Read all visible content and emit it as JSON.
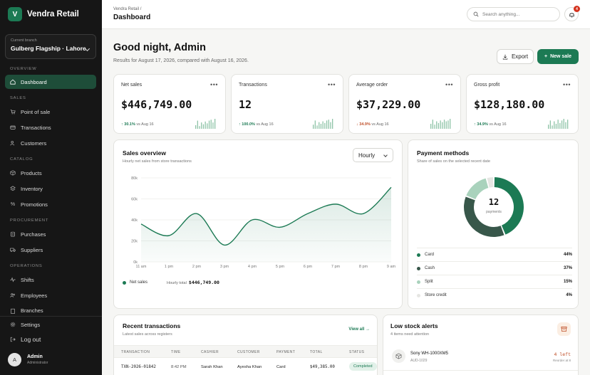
{
  "brand": {
    "logo_letter": "V",
    "name": "Vendra Retail"
  },
  "branch": {
    "label": "Current branch",
    "value": "Gulberg Flagship · Lahore"
  },
  "sidebar": {
    "sections": [
      {
        "title": "OVERVIEW",
        "items": [
          {
            "label": "Dashboard",
            "icon": "home-icon",
            "active": true
          }
        ]
      },
      {
        "title": "SALES",
        "items": [
          {
            "label": "Point of sale",
            "icon": "cart-icon"
          },
          {
            "label": "Transactions",
            "icon": "card-icon"
          },
          {
            "label": "Customers",
            "icon": "users-icon"
          }
        ]
      },
      {
        "title": "CATALOG",
        "items": [
          {
            "label": "Products",
            "icon": "box-icon"
          },
          {
            "label": "Inventory",
            "icon": "layers-icon"
          },
          {
            "label": "Promotions",
            "icon": "percent-icon"
          }
        ]
      },
      {
        "title": "PROCUREMENT",
        "items": [
          {
            "label": "Purchases",
            "icon": "clipboard-icon"
          },
          {
            "label": "Suppliers",
            "icon": "truck-icon"
          }
        ]
      },
      {
        "title": "OPERATIONS",
        "items": [
          {
            "label": "Shifts",
            "icon": "pulse-icon"
          },
          {
            "label": "Employees",
            "icon": "people-icon"
          },
          {
            "label": "Branches",
            "icon": "building-icon"
          }
        ]
      }
    ],
    "settings_label": "Settings",
    "logout_label": "Log out",
    "user": {
      "initial": "A",
      "name": "Admin",
      "role": "Administrator"
    }
  },
  "header": {
    "breadcrumb": "Vendra Retail /",
    "title": "Dashboard",
    "search_placeholder": "Search anything...",
    "notification_count": "4"
  },
  "greeting": {
    "title": "Good night, Admin",
    "subtitle": "Results for August 17, 2026, compared with August 16, 2026.",
    "export_label": "Export",
    "new_sale_label": "New sale"
  },
  "kpis": [
    {
      "label": "Net sales",
      "value": "$446,749.00",
      "delta": "30.1%",
      "direction": "up",
      "compare": "vs Aug 16",
      "spark": [
        4,
        9,
        3,
        7,
        5,
        8,
        6,
        9,
        10,
        7,
        11
      ]
    },
    {
      "label": "Transactions",
      "value": "12",
      "delta": "100.0%",
      "direction": "up",
      "compare": "vs Aug 16",
      "spark": [
        5,
        10,
        4,
        8,
        6,
        9,
        7,
        10,
        11,
        8,
        12
      ]
    },
    {
      "label": "Average order",
      "value": "$37,229.00",
      "delta": "34.9%",
      "direction": "down",
      "compare": "vs Aug 16",
      "spark": [
        6,
        11,
        5,
        9,
        7,
        10,
        8,
        11,
        9,
        10,
        12
      ]
    },
    {
      "label": "Gross profit",
      "value": "$128,180.00",
      "delta": "34.9%",
      "direction": "up",
      "compare": "vs Aug 16",
      "spark": [
        5,
        10,
        4,
        9,
        6,
        11,
        7,
        10,
        12,
        8,
        11
      ]
    }
  ],
  "sales_overview": {
    "title": "Sales overview",
    "subtitle": "Hourly net sales from store transactions",
    "range": "Hourly",
    "legend": "Net sales",
    "hourly_total_label": "Hourly total",
    "hourly_total_value": "$446,749.00",
    "color": "#1c7a54"
  },
  "chart_data": {
    "type": "area",
    "categories": [
      "11 am",
      "1 pm",
      "2 pm",
      "3 pm",
      "4 pm",
      "5 pm",
      "6 pm",
      "7 pm",
      "8 pm",
      "9 am"
    ],
    "series": [
      {
        "name": "Net sales",
        "values": [
          36000,
          25000,
          46000,
          16000,
          40000,
          33000,
          46000,
          55000,
          46000,
          71000
        ]
      }
    ],
    "yticks": [
      "0k",
      "20k",
      "40k",
      "60k",
      "80k"
    ],
    "ylim": [
      0,
      80000
    ],
    "grid": true
  },
  "payment_methods": {
    "title": "Payment methods",
    "subtitle": "Share of sales on the selected recent date",
    "center_value": "12",
    "center_label": "payments",
    "items": [
      {
        "label": "Card",
        "pct": "44%",
        "value": 44,
        "color": "#1c7a54"
      },
      {
        "label": "Cash",
        "pct": "37%",
        "value": 37,
        "color": "#38574a"
      },
      {
        "label": "Split",
        "pct": "15%",
        "value": 15,
        "color": "#a9d2bc"
      },
      {
        "label": "Store credit",
        "pct": "4%",
        "value": 4,
        "color": "#e6e6e3"
      }
    ]
  },
  "recent_transactions": {
    "title": "Recent transactions",
    "subtitle": "Latest sales across registers",
    "view_all": "View all →",
    "columns": [
      "TRANSACTION",
      "TIME",
      "CASHIER",
      "CUSTOMER",
      "PAYMENT",
      "TOTAL",
      "STATUS"
    ],
    "rows": [
      {
        "id": "TXN-2026-01842",
        "time": "8:42 PM",
        "cashier": "Sarah Khan",
        "customer": "Ayesha Khan",
        "payment": "Card",
        "total": "$49,385.00",
        "status": "Completed"
      }
    ]
  },
  "low_stock": {
    "title": "Low stock alerts",
    "subtitle": "4 items need attention",
    "items": [
      {
        "name": "Sony WH-1000XM5",
        "sku": "AUD-1029",
        "left": "4 left",
        "reorder": "Reorder at 8"
      }
    ]
  }
}
